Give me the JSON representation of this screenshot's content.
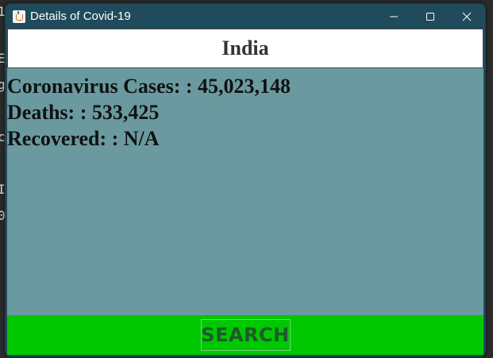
{
  "background": {
    "edge_chars": [
      "1",
      "E",
      "g",
      "c",
      "I",
      "0"
    ]
  },
  "window": {
    "title": "Details of Covid-19",
    "controls": [
      "minimize",
      "maximize",
      "close"
    ]
  },
  "country": {
    "name": "India"
  },
  "stats": {
    "cases_label": "Coronavirus Cases: : 45,023,148",
    "deaths_label": "Deaths: : 533,425",
    "recovered_label": "Recovered: : N/A"
  },
  "search": {
    "button_label": "SEARCH"
  },
  "colors": {
    "titlebar": "#1f4b5c",
    "content_bg": "#6a9aa0",
    "search_bar": "#00c800",
    "search_text": "#1d5a2c"
  }
}
